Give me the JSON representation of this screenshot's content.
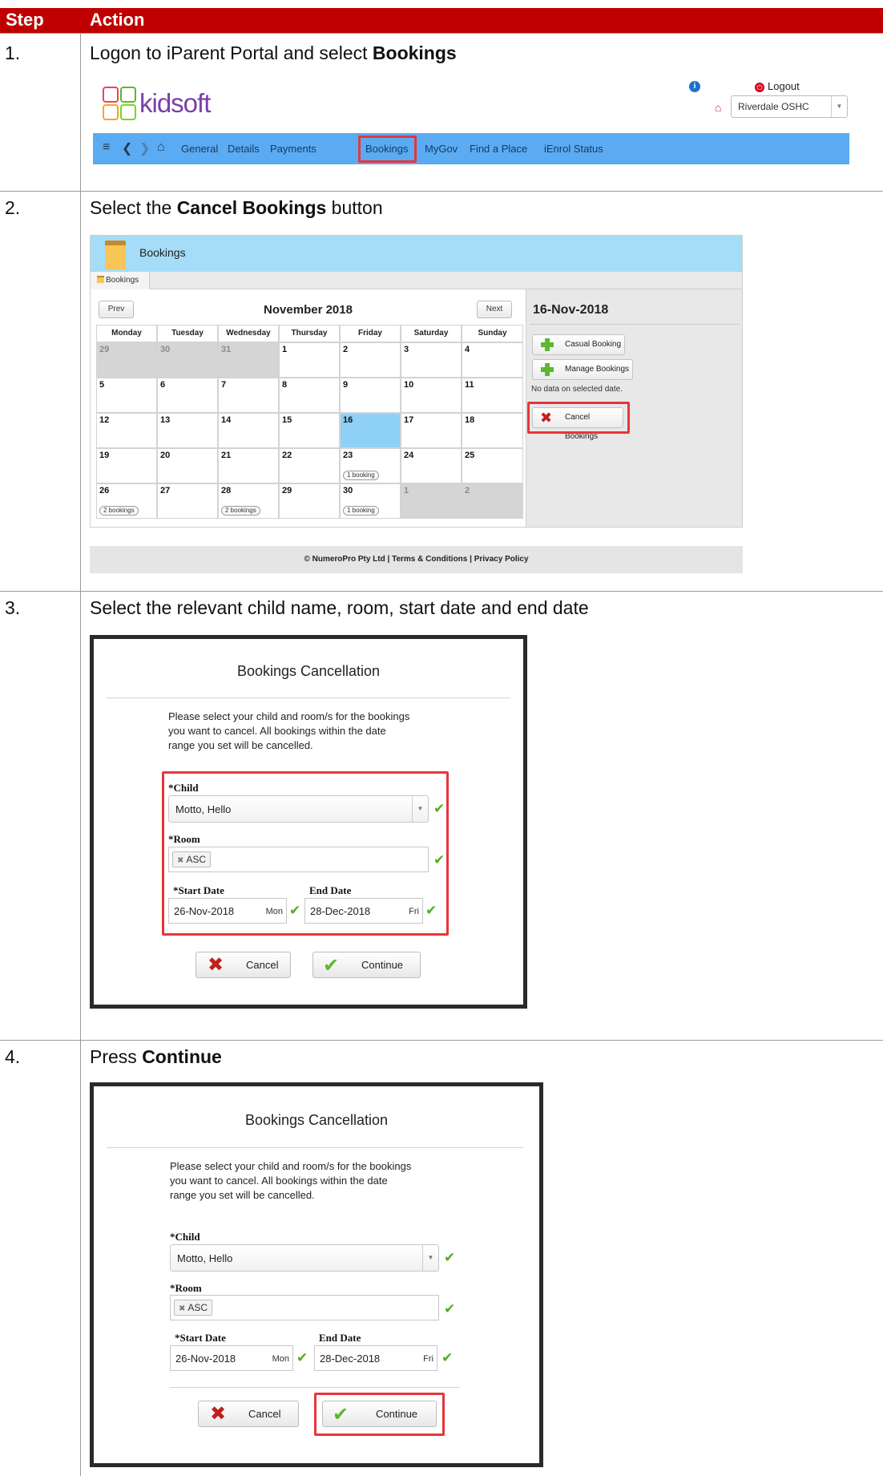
{
  "table": {
    "header": {
      "step": "Step",
      "action": "Action"
    },
    "steps": [
      {
        "num": "1.",
        "text_pre": "Logon to iParent Portal and select ",
        "text_bold": "Bookings",
        "text_post": ""
      },
      {
        "num": "2.",
        "text_pre": "Select the ",
        "text_bold": "Cancel Bookings",
        "text_post": " button"
      },
      {
        "num": "3.",
        "text_pre": "Select the relevant child name, room, start date and end date",
        "text_bold": "",
        "text_post": ""
      },
      {
        "num": "4.",
        "text_pre": "Press ",
        "text_bold": "Continue",
        "text_post": ""
      }
    ]
  },
  "kidsoft": {
    "logo": "kidsoft",
    "logout": "Logout",
    "service": "Riverdale OSHC",
    "nav": [
      "General",
      "Details",
      "Payments",
      "Bookings",
      "MyGov",
      "Find a Place",
      "iEnrol Status"
    ],
    "highlighted": "Bookings"
  },
  "bookings": {
    "title": "Bookings",
    "tab": "Bookings",
    "prev": "Prev",
    "next": "Next",
    "month": "November 2018",
    "weekdays": [
      "Monday",
      "Tuesday",
      "Wednesday",
      "Thursday",
      "Friday",
      "Saturday",
      "Sunday"
    ],
    "weeks": [
      [
        {
          "d": "29",
          "m": true
        },
        {
          "d": "30",
          "m": true
        },
        {
          "d": "31",
          "m": true
        },
        {
          "d": "1"
        },
        {
          "d": "2"
        },
        {
          "d": "3"
        },
        {
          "d": "4"
        }
      ],
      [
        {
          "d": "5"
        },
        {
          "d": "6"
        },
        {
          "d": "7"
        },
        {
          "d": "8"
        },
        {
          "d": "9"
        },
        {
          "d": "10"
        },
        {
          "d": "11"
        }
      ],
      [
        {
          "d": "12"
        },
        {
          "d": "13"
        },
        {
          "d": "14"
        },
        {
          "d": "15"
        },
        {
          "d": "16",
          "s": true
        },
        {
          "d": "17"
        },
        {
          "d": "18"
        }
      ],
      [
        {
          "d": "19"
        },
        {
          "d": "20"
        },
        {
          "d": "21"
        },
        {
          "d": "22"
        },
        {
          "d": "23",
          "b": "1 booking"
        },
        {
          "d": "24"
        },
        {
          "d": "25"
        }
      ],
      [
        {
          "d": "26",
          "b": "2 bookings"
        },
        {
          "d": "27"
        },
        {
          "d": "28",
          "b": "2 bookings"
        },
        {
          "d": "29"
        },
        {
          "d": "30",
          "b": "1 booking"
        },
        {
          "d": "1",
          "m": true
        },
        {
          "d": "2",
          "m": true
        }
      ]
    ],
    "side": {
      "date": "16-Nov-2018",
      "casual": "Casual Booking",
      "manage": "Manage Bookings",
      "nodata": "No data on selected date.",
      "cancel": "Cancel Bookings"
    },
    "footer": "© NumeroPro Pty Ltd | Terms & Conditions | Privacy Policy"
  },
  "dialog": {
    "title": "Bookings Cancellation",
    "message_lines": [
      "Please select your child and room/s for the bookings",
      "you want to cancel. All bookings within the date",
      "range you set will be cancelled."
    ],
    "child_label": "*Child",
    "child_value": "Motto, Hello",
    "room_label": "*Room",
    "room_value": "ASC",
    "start_label": "*Start Date",
    "start_value": "26-Nov-2018",
    "start_day": "Mon",
    "end_label": "End Date",
    "end_value": "28-Dec-2018",
    "end_day": "Fri",
    "cancel": "Cancel",
    "continue": "Continue"
  },
  "colors": {
    "header": "#c00000",
    "nav": "#5aabf2",
    "highlight": "#e8353a",
    "selected_day": "#8fd0f7",
    "check": "#4fae1c"
  }
}
